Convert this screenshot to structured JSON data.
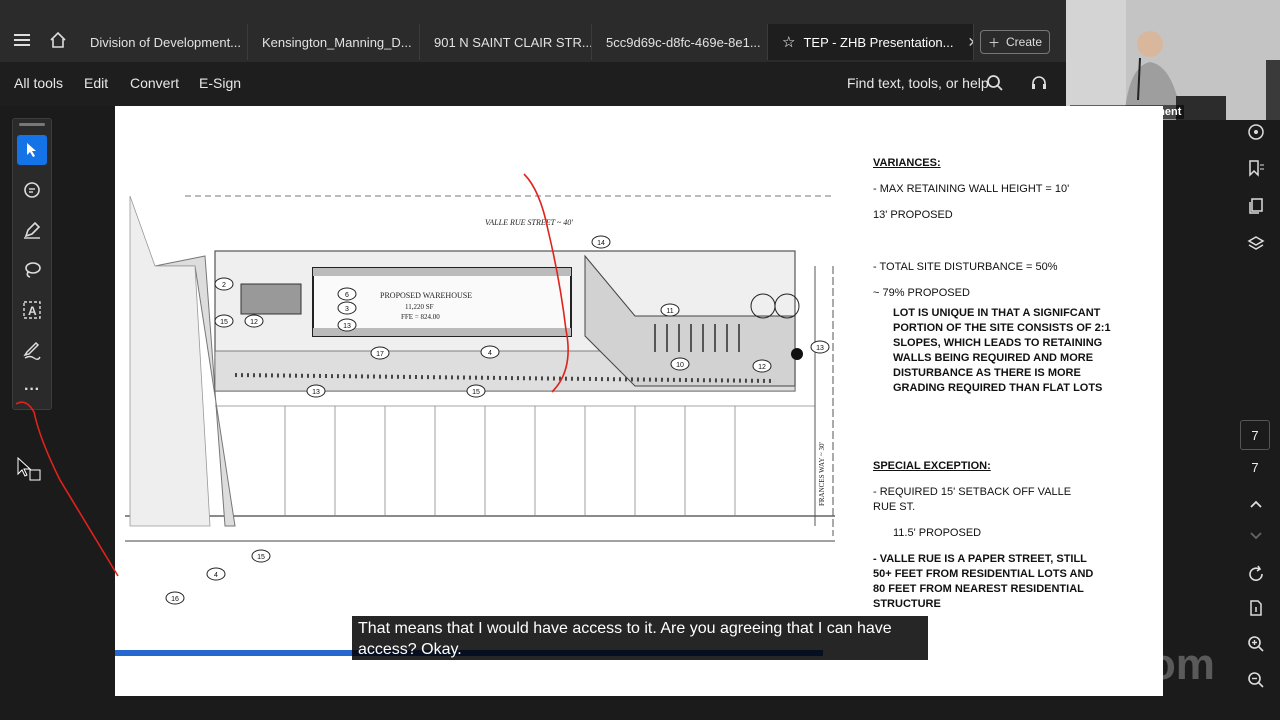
{
  "tabs": [
    {
      "label": "Division of Development..."
    },
    {
      "label": "Kensington_Manning_D..."
    },
    {
      "label": "901 N SAINT CLAIR STR..."
    },
    {
      "label": "5cc9d69c-d8fc-469e-8e1..."
    },
    {
      "label": "TEP - ZHB Presentation..."
    }
  ],
  "create_label": "Create",
  "menu": [
    "All tools",
    "Edit",
    "Convert",
    "E-Sign"
  ],
  "find_label": "Find text, tools, or help",
  "video": {
    "label": "Board of Adjustment"
  },
  "page": {
    "current": "7",
    "total": "7"
  },
  "plan": {
    "street_label": "VALLE RUE STREET ~ 40'",
    "warehouse_label": "PROPOSED WAREHOUSE",
    "warehouse_area": "11,220 SF",
    "ffe": "FFE = 824.00",
    "side_street": "FRANCES WAY ~ 30'"
  },
  "notes": {
    "variances_heading": "VARIANCES:",
    "max_wall": "- MAX RETAINING WALL HEIGHT = 10'",
    "wall_proposed": "13' PROPOSED",
    "disturbance": "- TOTAL SITE DISTURBANCE = 50%",
    "disturbance_proposed": "~ 79% PROPOSED",
    "unique": "LOT IS UNIQUE IN THAT A SIGNIFCANT PORTION OF THE SITE CONSISTS OF 2:1 SLOPES, WHICH LEADS TO RETAINING WALLS BEING REQUIRED AND MORE DISTURBANCE AS THERE IS MORE GRADING REQUIRED THAN FLAT LOTS",
    "exception_heading": "SPECIAL EXCEPTION:",
    "setback": "- REQUIRED 15' SETBACK OFF VALLE RUE ST.",
    "setback_proposed": "11.5' PROPOSED",
    "paper_street": "- VALLE RUE IS A PAPER STREET, STILL 50+ FEET FROM RESIDENTIAL LOTS AND 80 FEET FROM NEAREST RESIDENTIAL STRUCTURE"
  },
  "caption": "That means that I would have access to it. Are you agreeing that I can have access? Okay.",
  "watermark": "zoom",
  "colors": {
    "accent": "#1473e6",
    "annotation": "#e0231b",
    "progress": "#2468d0"
  }
}
